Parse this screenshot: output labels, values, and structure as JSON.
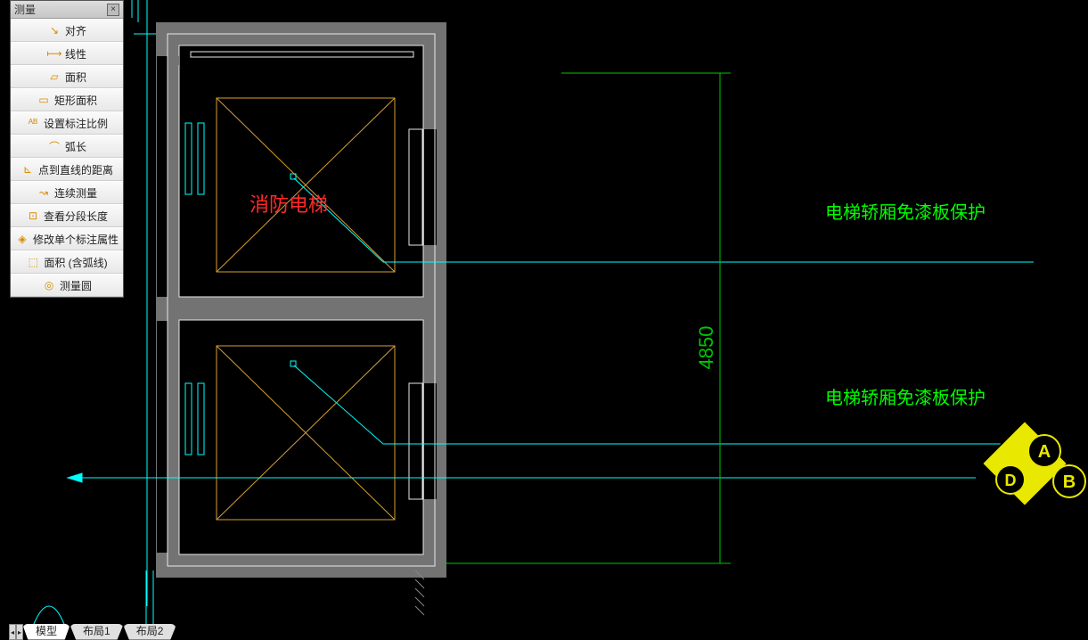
{
  "palette": {
    "title": "测量",
    "close_glyph": "×",
    "items": [
      {
        "icon": "align-icon",
        "icon_color": "blue",
        "glyph": "↘",
        "label": "对齐"
      },
      {
        "icon": "linear-icon",
        "icon_color": "blue",
        "glyph": "⟼",
        "label": "线性"
      },
      {
        "icon": "area-icon",
        "icon_color": "blue",
        "glyph": "▱",
        "label": "面积"
      },
      {
        "icon": "rect-area-icon",
        "icon_color": "blue",
        "glyph": "▭",
        "label": "矩形面积"
      },
      {
        "icon": "scale-icon",
        "icon_color": "blue",
        "glyph": "ᴬᴮ",
        "label": "设置标注比例"
      },
      {
        "icon": "arc-length-icon",
        "icon_color": "orange",
        "glyph": "⌒",
        "label": "弧长"
      },
      {
        "icon": "point-line-icon",
        "icon_color": "orange",
        "glyph": "⊾",
        "label": "点到直线的距离"
      },
      {
        "icon": "continuous-icon",
        "icon_color": "orange",
        "glyph": "↝",
        "label": "连续测量"
      },
      {
        "icon": "segment-length-icon",
        "icon_color": "orange",
        "glyph": "⊡",
        "label": "查看分段长度"
      },
      {
        "icon": "edit-dim-icon",
        "icon_color": "orange",
        "glyph": "◈",
        "label": "修改单个标注属性"
      },
      {
        "icon": "area-arc-icon",
        "icon_color": "orange",
        "glyph": "⬚",
        "label": "面积 (含弧线)"
      },
      {
        "icon": "circle-measure-icon",
        "icon_color": "orange",
        "glyph": "◎",
        "label": "测量圆"
      }
    ]
  },
  "drawing": {
    "label_fire_elevator": "消防电梯",
    "annotation_1": "电梯轿厢免漆板保护",
    "annotation_2": "电梯轿厢免漆板保护",
    "dimension_vertical": "4850",
    "view_labels": {
      "a": "A",
      "b": "B",
      "d": "D"
    }
  },
  "tabs": {
    "nav_prev": "◂",
    "nav_next": "▸",
    "items": [
      {
        "label": "模型",
        "active": true
      },
      {
        "label": "布局1",
        "active": false
      },
      {
        "label": "布局2",
        "active": false
      }
    ]
  }
}
